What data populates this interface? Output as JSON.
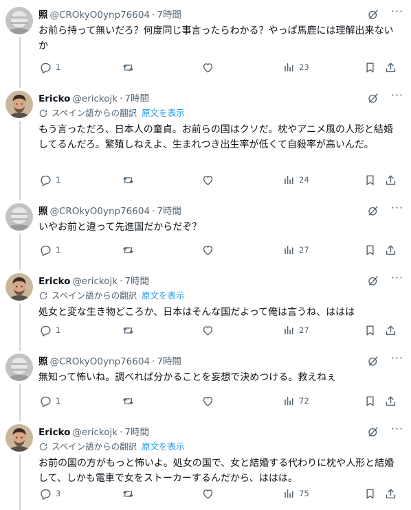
{
  "tweets": [
    {
      "avatar": "blurred-avatar",
      "name": "照",
      "handle": "@CROkyO0ynp76604",
      "time": "7時間",
      "translated": false,
      "text": "お前ら持って無いだろ？何度同じ事言ったらわかる？やっぱ馬鹿には理解出来ないか",
      "replies": "1",
      "retweets": "",
      "likes": "",
      "views": "23"
    },
    {
      "avatar": "man-avatar",
      "name": "Ericko",
      "handle": "@erickojk",
      "time": "7時間",
      "translated": true,
      "text": "もう言っただろ、日本人の童貞。お前らの国はクソだ。枕やアニメ風の人形と結婚してるんだろ。繁殖しねえよ、生まれつき出生率が低くて自殺率が高いんだ。",
      "replies": "1",
      "retweets": "",
      "likes": "",
      "views": "24"
    },
    {
      "avatar": "blurred-avatar",
      "name": "照",
      "handle": "@CROkyO0ynp76604",
      "time": "7時間",
      "translated": false,
      "text": "いやお前と違って先進国だからだぞ？",
      "replies": "1",
      "retweets": "",
      "likes": "",
      "views": "27"
    },
    {
      "avatar": "man-avatar",
      "name": "Ericko",
      "handle": "@erickojk",
      "time": "7時間",
      "translated": true,
      "text": "処女と変な生き物どころか、日本はそんな国だよって俺は言うね、ははは",
      "replies": "1",
      "retweets": "",
      "likes": "",
      "views": "27"
    },
    {
      "avatar": "blurred-avatar",
      "name": "照",
      "handle": "@CROkyO0ynp76604",
      "time": "7時間",
      "translated": false,
      "text": "無知って怖いね。調べれば分かることを妄想で決めつける。救えねぇ",
      "replies": "1",
      "retweets": "",
      "likes": "",
      "views": "72"
    },
    {
      "avatar": "man-avatar",
      "name": "Ericko",
      "handle": "@erickojk",
      "time": "7時間",
      "translated": true,
      "text": "お前の国の方がもっと怖いよ。処女の国で、女と結婚する代わりに枕や人形と結婚して、しかも電車で女をストーカーするんだから、ははは。",
      "replies": "3",
      "retweets": "",
      "likes": "",
      "views": "75"
    }
  ],
  "ui": {
    "translate_label": "スペイン語からの翻訳",
    "show_original": "原文を表示",
    "dot": "·",
    "more": "···"
  },
  "colors": {
    "text": "#0f1419",
    "muted": "#536471",
    "link": "#1d9bf0",
    "thread": "#cfd9de"
  }
}
